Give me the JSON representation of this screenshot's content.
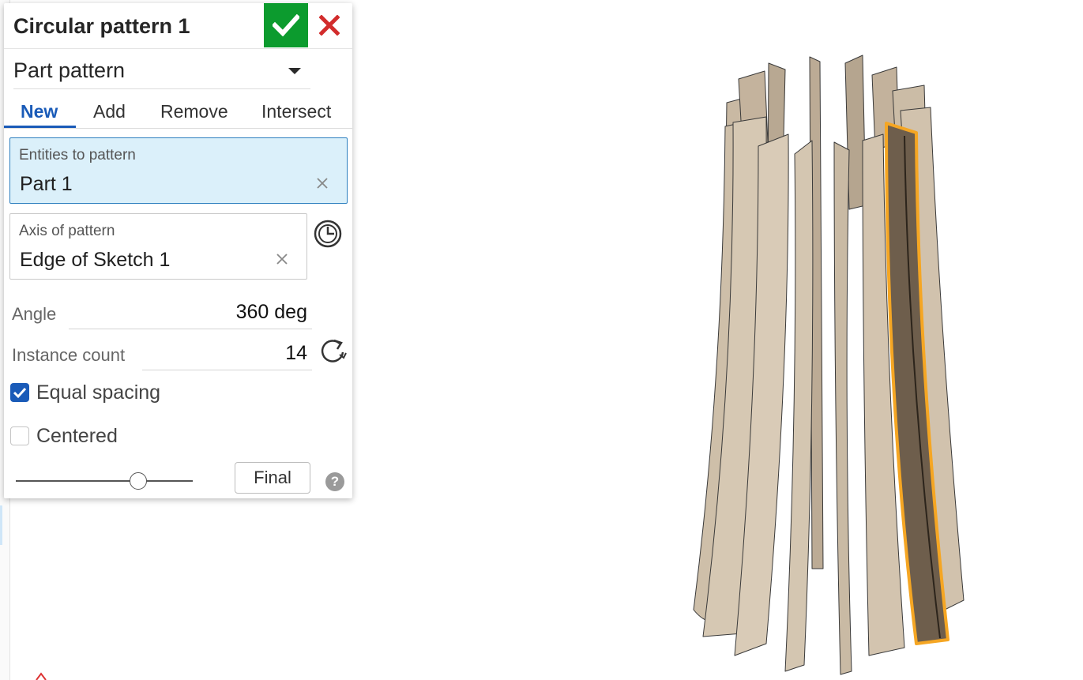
{
  "dialog": {
    "title": "Circular pattern 1",
    "pattern_type": "Part pattern",
    "tabs": [
      {
        "label": "New",
        "active": true
      },
      {
        "label": "Add",
        "active": false
      },
      {
        "label": "Remove",
        "active": false
      },
      {
        "label": "Intersect",
        "active": false
      }
    ],
    "entities": {
      "label": "Entities to pattern",
      "value": "Part 1"
    },
    "axis": {
      "label": "Axis of pattern",
      "value": "Edge of Sketch 1"
    },
    "angle": {
      "label": "Angle",
      "value": "360 deg"
    },
    "instance_count": {
      "label": "Instance count",
      "value": "14"
    },
    "equal_spacing": {
      "label": "Equal spacing",
      "checked": true
    },
    "centered": {
      "label": "Centered",
      "checked": false
    },
    "rollback_slider": {
      "level": 0.69
    },
    "final_label": "Final",
    "help_glyph": "?"
  },
  "icons": {
    "confirm": "checkmark-icon",
    "cancel": "close-icon",
    "clear": "clear-x-icon",
    "axis_selector": "axis-clock-icon",
    "flip": "redo-arrow-icon",
    "help": "question-icon"
  },
  "colors": {
    "accent": "#1a5bb8",
    "confirm_green": "#0c9b2e",
    "cancel_red": "#d22c2c",
    "selection_bg": "#dbf0fa",
    "highlight_orange": "#f5a623",
    "part_fill": "#d3c4b0",
    "selected_part_fill": "#6e5e4c"
  }
}
